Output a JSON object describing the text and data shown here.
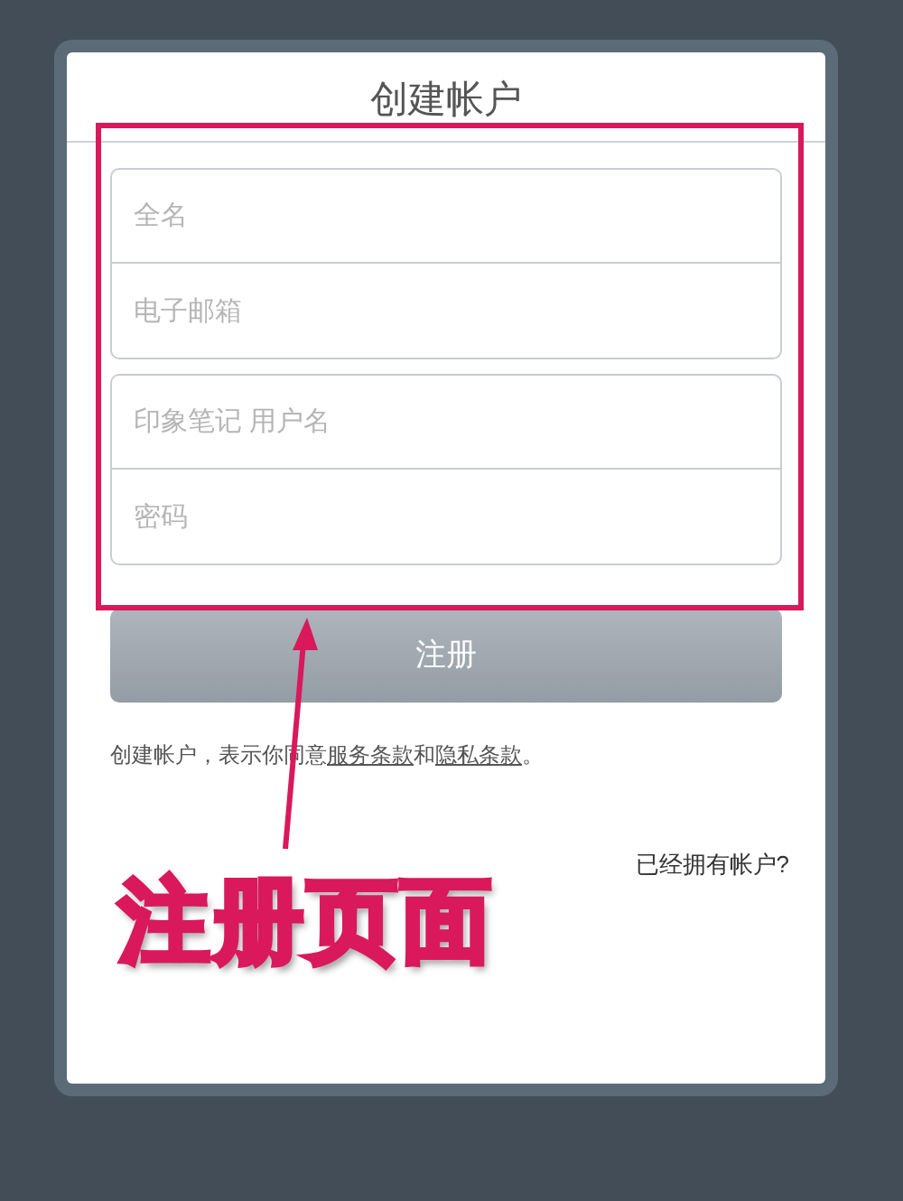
{
  "title": "创建帐户",
  "field_groups": [
    [
      {
        "placeholder": "全名"
      },
      {
        "placeholder": "电子邮箱"
      }
    ],
    [
      {
        "placeholder": "印象笔记 用户名"
      },
      {
        "placeholder": "密码"
      }
    ]
  ],
  "submit_button": {
    "label": "注册",
    "disabled": true
  },
  "terms": {
    "parts": [
      {
        "kind": "text",
        "text": "创建帐户，表示你同意"
      },
      {
        "kind": "link",
        "text": "服务条款"
      },
      {
        "kind": "text",
        "text": "和"
      },
      {
        "kind": "link",
        "text": "隐私条款"
      },
      {
        "kind": "text",
        "text": "。"
      }
    ]
  },
  "sign_in_link": "已经拥有帐户?",
  "annotation": {
    "label": "注册页面"
  }
}
